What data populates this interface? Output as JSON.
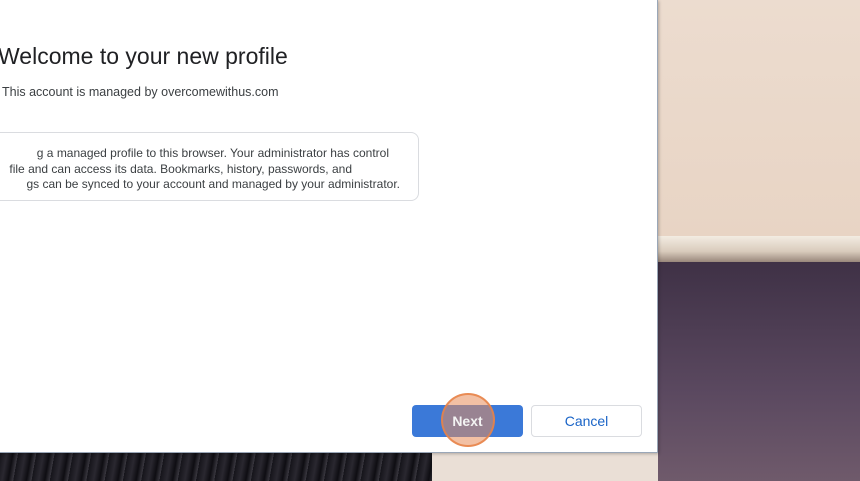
{
  "dialog": {
    "title": "Welcome to your new profile",
    "managed_line": "This account is managed by overcomewithus.com",
    "info_lines": [
      "g a managed profile to this browser. Your administrator has control",
      "file and can access its data. Bookmarks, history, passwords, and",
      "gs can be synced to your account and managed by your administrator."
    ]
  },
  "buttons": {
    "next_label": "Next",
    "cancel_label": "Cancel"
  },
  "colors": {
    "primary_button": "#3b79d8",
    "link_text": "#1a64c7",
    "click_marker": "#e88c5a"
  }
}
